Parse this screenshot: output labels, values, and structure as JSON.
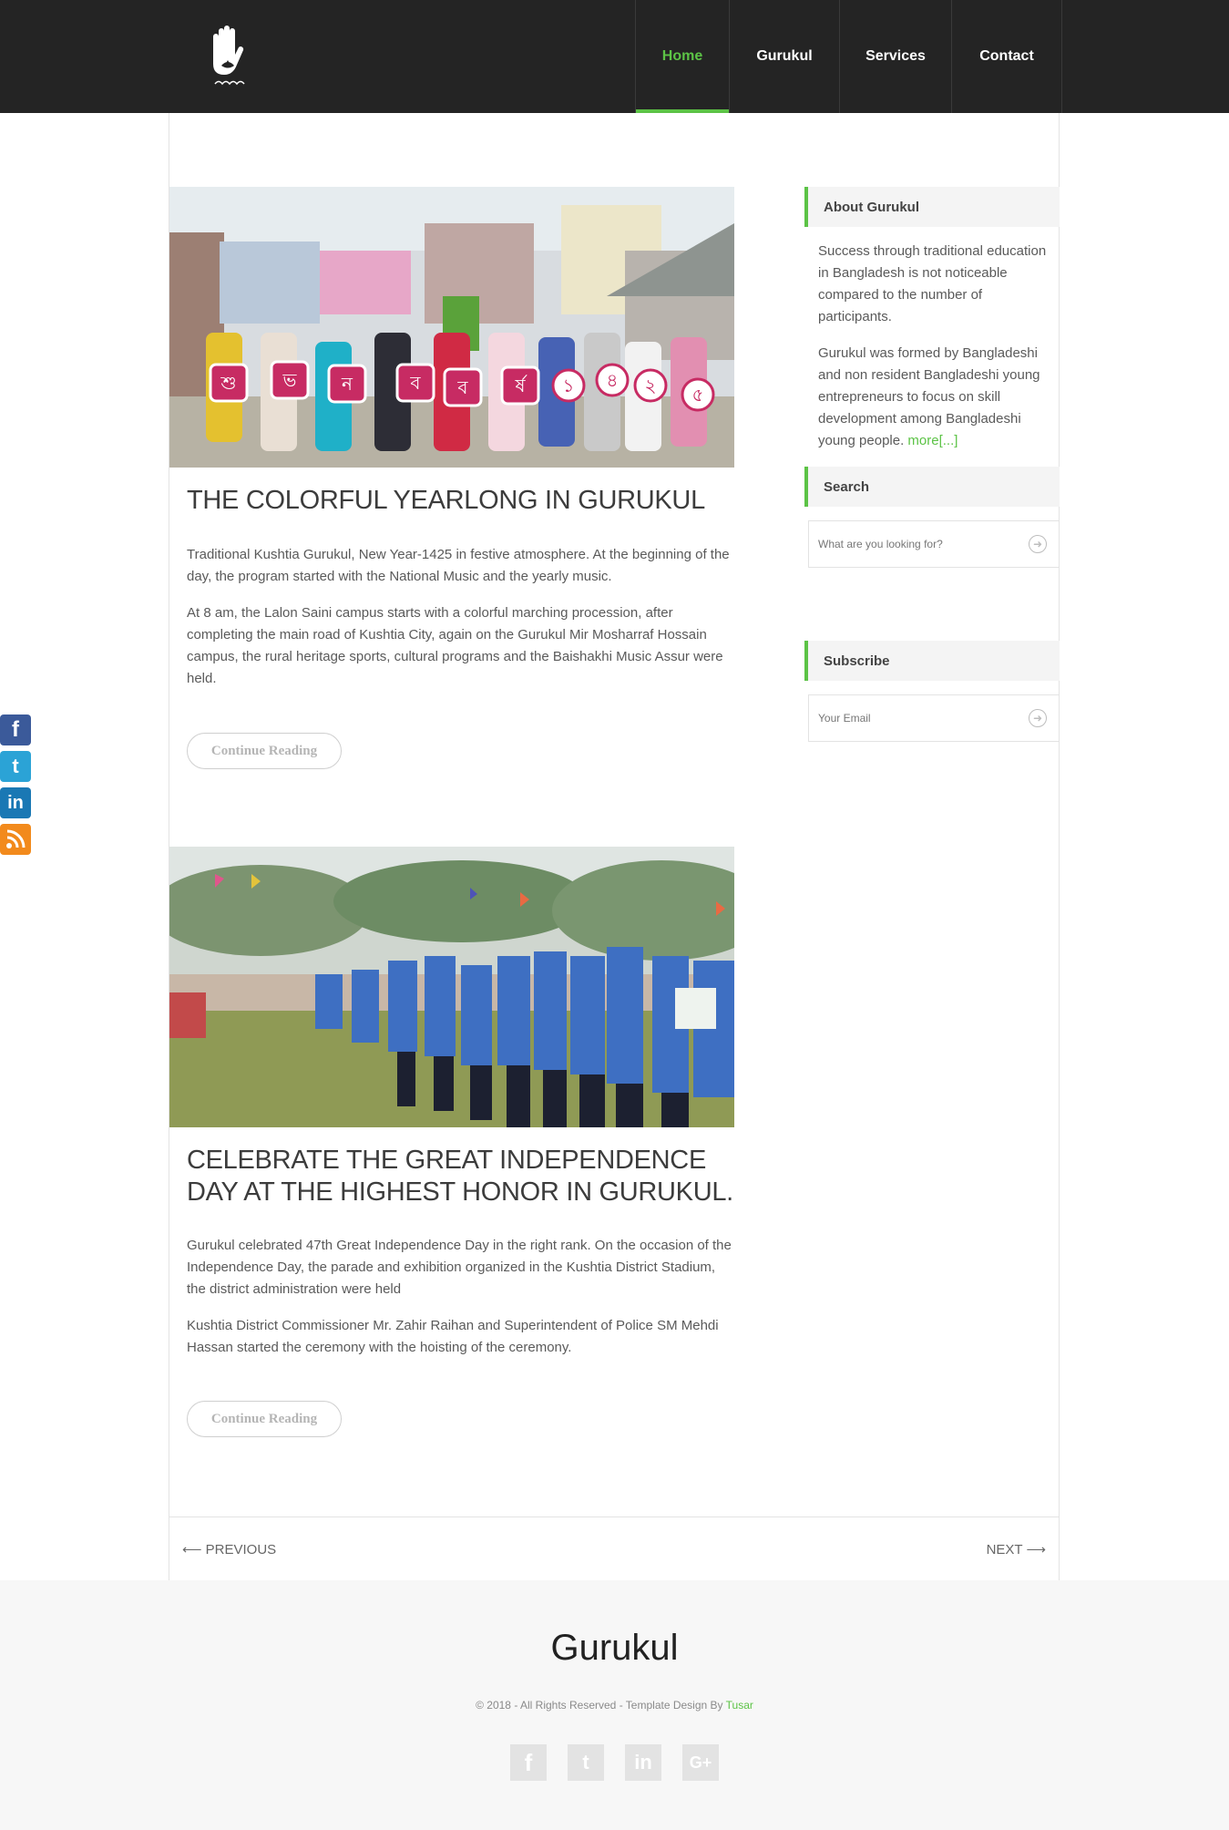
{
  "header": {
    "nav": [
      "Home",
      "Gurukul",
      "Services",
      "Contact"
    ],
    "active": "Home"
  },
  "posts": [
    {
      "title": "THE COLORFUL YEARLONG IN GURUKUL",
      "paragraphs": [
        "Traditional Kushtia Gurukul, New Year-1425 in festive atmosphere. At the beginning of the day, the program started with the National Music and the yearly music.",
        "At 8 am, the Lalon Saini campus starts with a colorful marching procession, after completing the main road of Kushtia City, again on the Gurukul Mir Mosharraf Hossain campus, the rural heritage sports, cultural programs and the Baishakhi Music Assur were held."
      ],
      "button": "Continue Reading",
      "sign_letters": [
        "শু",
        "ভ",
        "ন",
        "ব",
        "ব",
        "র্ষ",
        "১",
        "৪",
        "২",
        "৫"
      ]
    },
    {
      "title": "CELEBRATE THE GREAT INDEPENDENCE DAY AT THE HIGHEST HONOR IN GURUKUL.",
      "paragraphs": [
        "Gurukul celebrated 47th Great Independence Day in the right rank. On the occasion of the Independence Day, the parade and exhibition organized in the Kushtia District Stadium, the district administration were held",
        "Kushtia District Commissioner Mr. Zahir Raihan and Superintendent of Police SM Mehdi Hassan started the ceremony with the hoisting of the ceremony."
      ],
      "button": "Continue Reading"
    }
  ],
  "sidebar": {
    "about": {
      "title": "About Gurukul",
      "p1": "Success through traditional education in Bangladesh is not noticeable compared to the number of participants.",
      "p2": "Gurukul was formed by Bangladeshi and non resident Bangladeshi young entrepreneurs to focus on skill development among Bangladeshi young people.",
      "more": "more[...]"
    },
    "search": {
      "title": "Search",
      "placeholder": "What are you looking for?"
    },
    "subscribe": {
      "title": "Subscribe",
      "placeholder": "Your Email"
    }
  },
  "social_side": [
    "facebook-icon",
    "twitter-icon",
    "linkedin-icon",
    "rss-icon"
  ],
  "pager": {
    "prev": "⟵ PREVIOUS",
    "next": "NEXT ⟶"
  },
  "footer": {
    "title": "Gurukul",
    "copyright": "© 2018 - All Rights Reserved - Template Design By",
    "author": "Tusar",
    "social": [
      "facebook-icon",
      "twitter-icon",
      "linkedin-icon",
      "google-plus-icon"
    ]
  },
  "colors": {
    "accent": "#5cc346",
    "header_bg": "#242424",
    "footer_bg": "#f7f7f7"
  }
}
